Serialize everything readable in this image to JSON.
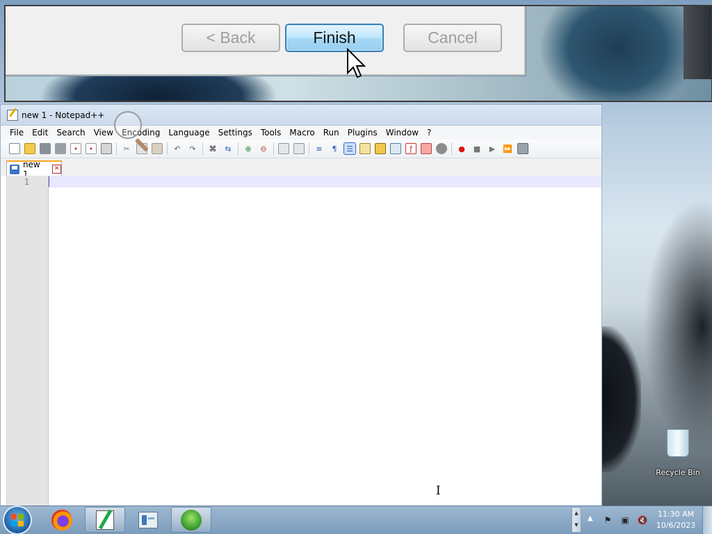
{
  "zoom_inset": {
    "buttons": {
      "back": "< Back",
      "finish": "Finish",
      "cancel": "Cancel"
    }
  },
  "window": {
    "title": "new 1 - Notepad++",
    "menu": [
      "File",
      "Edit",
      "Search",
      "View",
      "Encoding",
      "Language",
      "Settings",
      "Tools",
      "Macro",
      "Run",
      "Plugins",
      "Window",
      "?"
    ],
    "toolbar_icons": [
      "new-file-icon",
      "open-file-icon",
      "save-icon",
      "save-all-icon",
      "close-icon",
      "close-all-icon",
      "print-icon",
      "cut-icon",
      "copy-icon",
      "paste-icon",
      "undo-icon",
      "redo-icon",
      "find-icon",
      "replace-icon",
      "zoom-in-icon",
      "zoom-out-icon",
      "sync-vertical-icon",
      "sync-horizontal-icon",
      "word-wrap-icon",
      "show-all-characters-icon",
      "indent-guide-icon",
      "user-language-icon",
      "document-map-icon",
      "document-list-icon",
      "function-list-icon",
      "folder-as-workspace-icon",
      "monitoring-icon",
      "record-macro-icon",
      "stop-recording-icon",
      "play-macro-icon",
      "run-macro-multiple-icon",
      "save-macro-icon"
    ],
    "tab": {
      "label": "new 1"
    },
    "editor": {
      "line_numbers": [
        "1"
      ],
      "content": ""
    }
  },
  "desktop": {
    "recycle_bin_label": "Recycle Bin"
  },
  "taskbar": {
    "apps": [
      "firefox-icon",
      "notepadpp-icon",
      "task-manager-icon",
      "installer-icon"
    ],
    "clock": {
      "time": "11:30 AM",
      "date": "10/6/2023"
    }
  }
}
